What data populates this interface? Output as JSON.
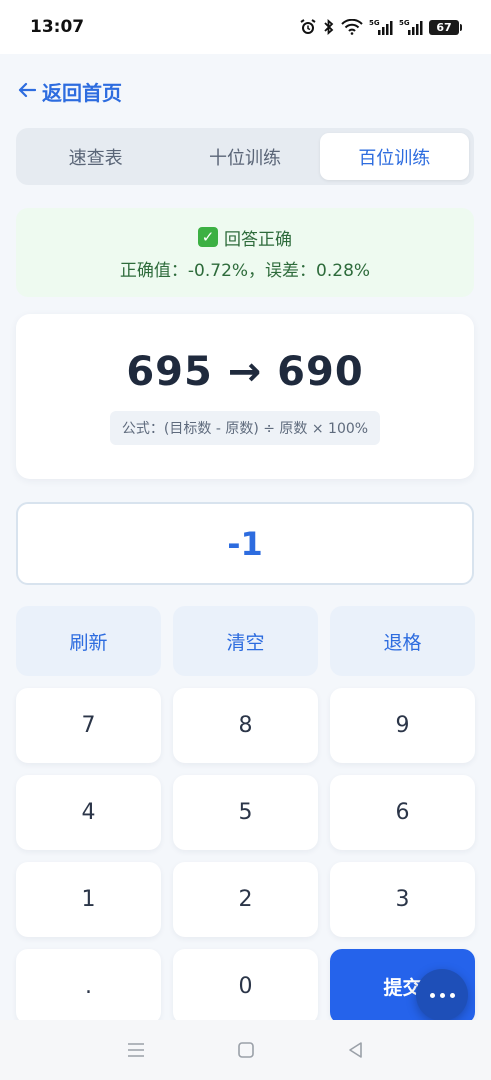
{
  "status": {
    "time": "13:07",
    "battery": "67"
  },
  "back": {
    "label": "返回首页"
  },
  "tabs": [
    {
      "label": "速查表"
    },
    {
      "label": "十位训练"
    },
    {
      "label": "百位训练"
    }
  ],
  "result": {
    "status_text": "回答正确",
    "detail": "正确值：-0.72%，误差：0.28%"
  },
  "question": {
    "text": "695 → 690",
    "formula": "公式：(目标数 - 原数) ÷ 原数 × 100%"
  },
  "answer": {
    "value": "-1"
  },
  "keypad": {
    "refresh": "刷新",
    "clear": "清空",
    "backspace": "退格",
    "k7": "7",
    "k8": "8",
    "k9": "9",
    "k4": "4",
    "k5": "5",
    "k6": "6",
    "k1": "1",
    "k2": "2",
    "k3": "3",
    "dot": ".",
    "k0": "0",
    "submit": "提交"
  },
  "colors": {
    "accent": "#2563eb",
    "success_bg": "#eefaf0",
    "success_text": "#2e6b3b"
  }
}
